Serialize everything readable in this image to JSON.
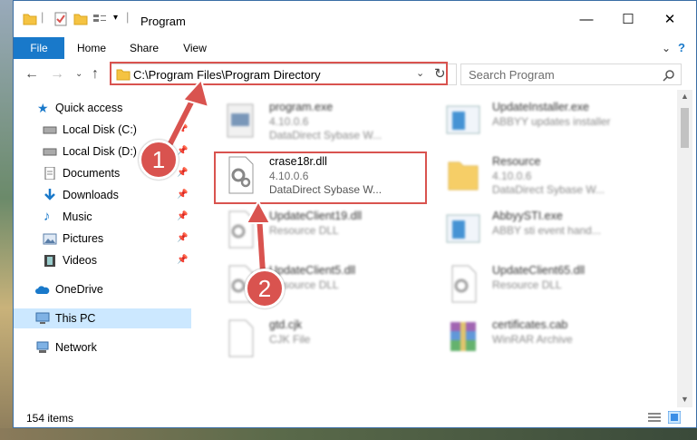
{
  "window": {
    "title": "Program",
    "controls": {
      "minimize": "—",
      "maximize": "☐",
      "close": "✕"
    }
  },
  "ribbon": {
    "tabs": [
      {
        "label": "File"
      },
      {
        "label": "Home"
      },
      {
        "label": "Share"
      },
      {
        "label": "View"
      }
    ]
  },
  "address": {
    "path": "C:\\Program Files\\Program Directory"
  },
  "search": {
    "placeholder": "Search Program"
  },
  "nav": {
    "items": [
      {
        "label": "Quick access"
      },
      {
        "label": "Local Disk (C:)"
      },
      {
        "label": "Local Disk (D:)"
      },
      {
        "label": "Documents"
      },
      {
        "label": "Downloads"
      },
      {
        "label": "Music"
      },
      {
        "label": "Pictures"
      },
      {
        "label": "Videos"
      },
      {
        "label": "OneDrive"
      },
      {
        "label": "This PC"
      },
      {
        "label": "Network"
      }
    ]
  },
  "files": [
    {
      "name": "program.exe",
      "version": "4.10.0.6",
      "desc": "DataDirect Sybase W..."
    },
    {
      "name": "UpdateInstaller.exe",
      "version": "",
      "desc": "ABBYY updates installer"
    },
    {
      "name": "crase18r.dll",
      "version": "4.10.0.6",
      "desc": "DataDirect Sybase W..."
    },
    {
      "name": "Resource",
      "version": "4.10.0.6",
      "desc": "DataDirect Sybase W..."
    },
    {
      "name": "UpdateClient19.dll",
      "version": "",
      "desc": "Resource DLL"
    },
    {
      "name": "AbbyySTI.exe",
      "version": "",
      "desc": "ABBY sti event hand..."
    },
    {
      "name": "UpdateClient5.dll",
      "version": "",
      "desc": "Resource DLL"
    },
    {
      "name": "UpdateClient65.dll",
      "version": "",
      "desc": "Resource DLL"
    },
    {
      "name": "gtd.cjk",
      "version": "",
      "desc": "CJK File"
    },
    {
      "name": "certificates.cab",
      "version": "",
      "desc": "WinRAR Archive"
    }
  ],
  "status": {
    "count": "154 items"
  },
  "annotations": {
    "step1": "1",
    "step2": "2"
  },
  "colors": {
    "accent": "#1979ca",
    "highlight": "#d9534f",
    "selected": "#cce8ff"
  }
}
